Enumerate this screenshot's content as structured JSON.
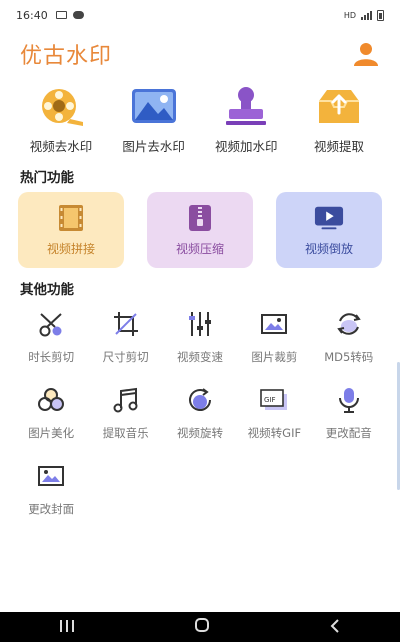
{
  "status_bar": {
    "time": "16:40",
    "network": "HD"
  },
  "header": {
    "title": "优古水印"
  },
  "top_actions": [
    {
      "label": "视频去水印",
      "icon": "film-reel-icon"
    },
    {
      "label": "图片去水印",
      "icon": "image-icon"
    },
    {
      "label": "视频加水印",
      "icon": "stamp-icon"
    },
    {
      "label": "视频提取",
      "icon": "tray-upload-icon"
    }
  ],
  "hot_section": {
    "title": "热门功能",
    "cards": [
      {
        "label": "视频拼接",
        "icon": "film-strip-icon",
        "bg": "#fde9bf",
        "color": "#c5832b"
      },
      {
        "label": "视频压缩",
        "icon": "zip-icon",
        "bg": "#ecd9f2",
        "color": "#8a4da0"
      },
      {
        "label": "视频倒放",
        "icon": "play-screen-icon",
        "bg": "#cdd4f8",
        "color": "#3b4c9e"
      }
    ]
  },
  "other_section": {
    "title": "其他功能",
    "items": [
      {
        "label": "时长剪切",
        "icon": "scissors-icon"
      },
      {
        "label": "尺寸剪切",
        "icon": "crop-icon"
      },
      {
        "label": "视频变速",
        "icon": "sliders-icon"
      },
      {
        "label": "图片裁剪",
        "icon": "image-crop-icon"
      },
      {
        "label": "MD5转码",
        "icon": "refresh-icon"
      },
      {
        "label": "图片美化",
        "icon": "beautify-icon"
      },
      {
        "label": "提取音乐",
        "icon": "music-note-icon"
      },
      {
        "label": "视频旋转",
        "icon": "rotate-icon"
      },
      {
        "label": "视频转GIF",
        "icon": "gif-icon"
      },
      {
        "label": "更改配音",
        "icon": "microphone-icon"
      },
      {
        "label": "更改封面",
        "icon": "cover-image-icon"
      }
    ]
  },
  "colors": {
    "brand": "#e8883a",
    "icon_dark": "#333333",
    "icon_accent": "#7d7ee8"
  }
}
